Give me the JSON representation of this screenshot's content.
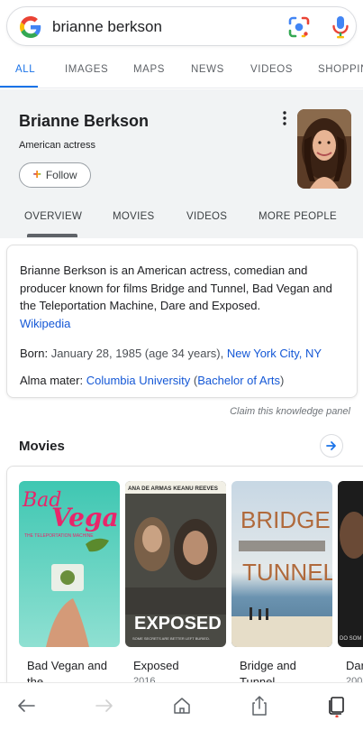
{
  "search": {
    "query": "brianne berkson"
  },
  "tabs": [
    "ALL",
    "IMAGES",
    "MAPS",
    "NEWS",
    "VIDEOS",
    "SHOPPIN"
  ],
  "panel": {
    "name": "Brianne Berkson",
    "subtitle": "American actress",
    "follow_label": "Follow",
    "tabs": [
      "OVERVIEW",
      "MOVIES",
      "VIDEOS",
      "MORE PEOPLE"
    ]
  },
  "description": {
    "text": "Brianne Berkson is an American actress, comedian and producer known for films Bridge and Tunnel, Bad Vegan and the Teleportation Machine, Dare and Exposed.",
    "source": "Wikipedia",
    "born_label": "Born:",
    "born_value": "January 28, 1985 (age 34 years),",
    "born_place": "New York City, NY",
    "alma_label": "Alma mater:",
    "alma_school": "Columbia University",
    "alma_degree": "Bachelor of Arts"
  },
  "claim_label": "Claim this knowledge panel",
  "movies": {
    "heading": "Movies",
    "items": [
      {
        "title": "Bad Vegan and the",
        "year": "",
        "poster_text": [
          "Bad",
          "Vegan",
          "THE TELEPORTATION MACHINE"
        ]
      },
      {
        "title": "Exposed",
        "year": "2016",
        "poster_text": [
          "ANA DE ARMAS  KEANU REEVES",
          "EXPOSED",
          "SOME SECRETS ARE BETTER LEFT BURIED."
        ]
      },
      {
        "title": "Bridge and Tunnel",
        "year": "",
        "poster_text": [
          "BRIDGE",
          "TUNNEL"
        ]
      },
      {
        "title": "Dar",
        "year": "200",
        "poster_text": [
          "DO SOM"
        ]
      }
    ]
  },
  "colors": {
    "accent": "#1a73e8",
    "panel_bg": "#f1f3f4",
    "link": "#1558d6"
  },
  "icons": [
    "google-g-icon",
    "lens-icon",
    "mic-icon",
    "kebab-icon",
    "plus-icon",
    "arrow-right-icon",
    "back-icon",
    "forward-icon",
    "home-icon",
    "share-icon",
    "tabs-icon"
  ]
}
